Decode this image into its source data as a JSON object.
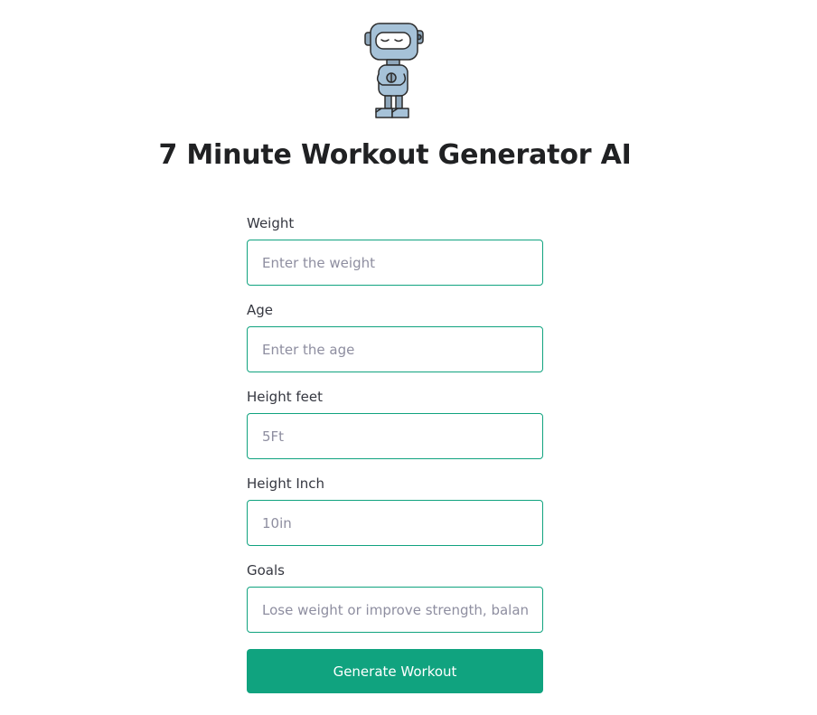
{
  "page": {
    "title": "7 Minute Workout Generator AI",
    "logo_icon": "robot-icon"
  },
  "form": {
    "fields": [
      {
        "label": "Weight",
        "placeholder": "Enter the weight",
        "value": ""
      },
      {
        "label": "Age",
        "placeholder": "Enter the age",
        "value": ""
      },
      {
        "label": "Height feet",
        "placeholder": "5Ft",
        "value": ""
      },
      {
        "label": "Height Inch",
        "placeholder": "10in",
        "value": ""
      },
      {
        "label": "Goals",
        "placeholder": "Lose weight or improve strength, balance",
        "value": ""
      }
    ],
    "submit_label": "Generate Workout"
  },
  "colors": {
    "accent": "#10a37f",
    "title_text": "#202123",
    "label_text": "#353740",
    "placeholder_text": "#8e8ea0",
    "robot_body": "#a6c2d8",
    "robot_outline": "#2b2b2b"
  }
}
